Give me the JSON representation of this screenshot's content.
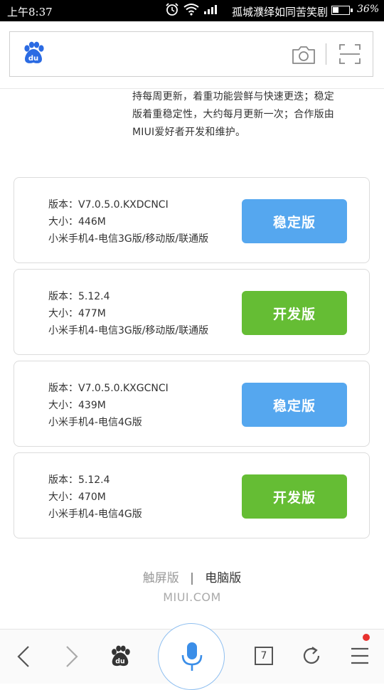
{
  "status_bar": {
    "time": "上午8:37",
    "song": "孤城濮绎如同苦笑剧",
    "battery_percent": "36%",
    "battery_level": 0.36
  },
  "header": {
    "logo_icon": "baidu-paw-icon",
    "camera_icon": "camera-icon",
    "scan_icon": "scan-icon"
  },
  "intro": {
    "line1": "持每周更新，着重功能尝鲜与快速更迭；稳定",
    "line2": "版着重稳定性，大约每月更新一次；合作版由",
    "line3": "MIUI爱好者开发和维护。"
  },
  "cards": [
    {
      "version": "版本：V7.0.5.0.KXDCNCI",
      "size": "大小：446M",
      "model": "小米手机4-电信3G版/移动版/联通版",
      "button": "稳定版",
      "color": "#55a7ef"
    },
    {
      "version": "版本：5.12.4",
      "size": "大小：477M",
      "model": "小米手机4-电信3G版/移动版/联通版",
      "button": "开发版",
      "color": "#65bd34"
    },
    {
      "version": "版本：V7.0.5.0.KXGCNCI",
      "size": "大小：439M",
      "model": "小米手机4-电信4G版",
      "button": "稳定版",
      "color": "#55a7ef"
    },
    {
      "version": "版本：5.12.4",
      "size": "大小：470M",
      "model": "小米手机4-电信4G版",
      "button": "开发版",
      "color": "#65bd34"
    }
  ],
  "footer": {
    "touch": "触屏版",
    "separator": "|",
    "pc": "电脑版",
    "domain": "MIUI.COM"
  },
  "toolbar": {
    "back_icon": "back-arrow-icon",
    "forward_icon": "forward-arrow-icon",
    "home_icon": "baidu-paw-icon",
    "mic_icon": "microphone-icon",
    "tab_count": "7",
    "refresh_icon": "refresh-icon",
    "menu_icon": "menu-icon"
  }
}
